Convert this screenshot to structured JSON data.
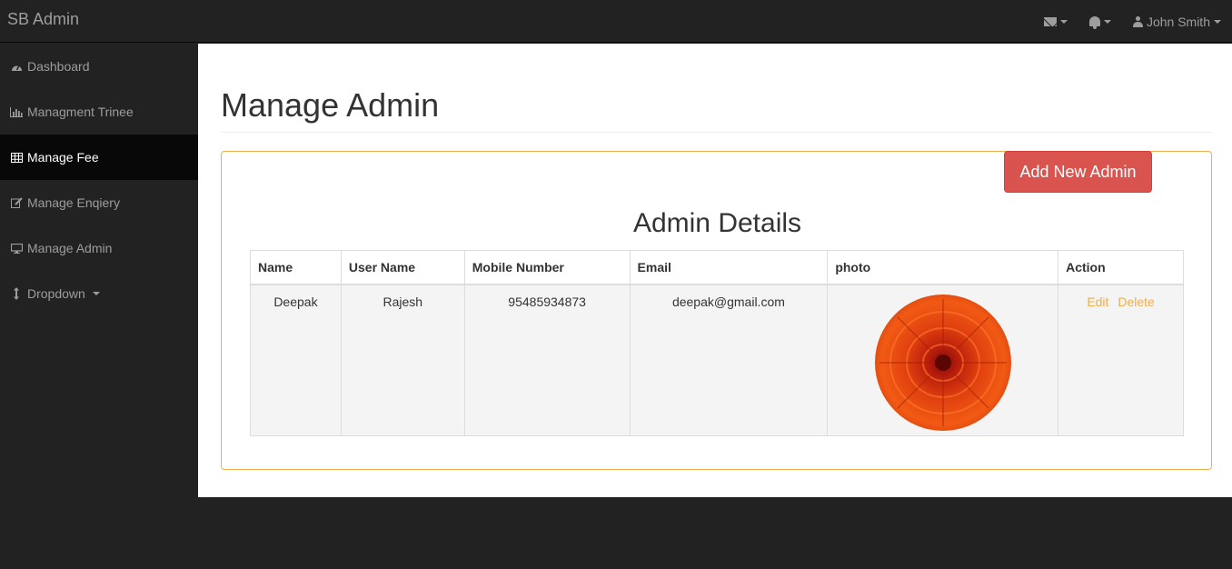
{
  "app": {
    "brand": "SB Admin"
  },
  "topnav": {
    "user_name": "John Smith"
  },
  "sidebar": {
    "items": [
      {
        "label": "Dashboard",
        "icon": "dashboard-icon"
      },
      {
        "label": "Managment Trinee",
        "icon": "bar-chart-icon"
      },
      {
        "label": "Manage Fee",
        "icon": "table-icon",
        "active": true
      },
      {
        "label": "Manage Enqiery",
        "icon": "edit-icon"
      },
      {
        "label": "Manage Admin",
        "icon": "desktop-icon"
      },
      {
        "label": "Dropdown",
        "icon": "arrows-v-icon"
      }
    ]
  },
  "main": {
    "page_title": "Manage Admin",
    "add_button_label": "Add New Admin",
    "table_title": "Admin Details",
    "columns": [
      "Name",
      "User Name",
      "Mobile Number",
      "Email",
      "photo",
      "Action"
    ],
    "rows": [
      {
        "name": "Deepak",
        "username": "Rajesh",
        "mobile": "95485934873",
        "email": "deepak@gmail.com",
        "photo": "orange-flower-photo",
        "edit_label": "Edit",
        "delete_label": "Delete"
      }
    ]
  },
  "colors": {
    "navbar_bg": "#222222",
    "sidebar_active_bg": "#080808",
    "panel_border": "#f0ad4e",
    "danger_button": "#d9534f",
    "action_link": "#f0ad4e"
  }
}
